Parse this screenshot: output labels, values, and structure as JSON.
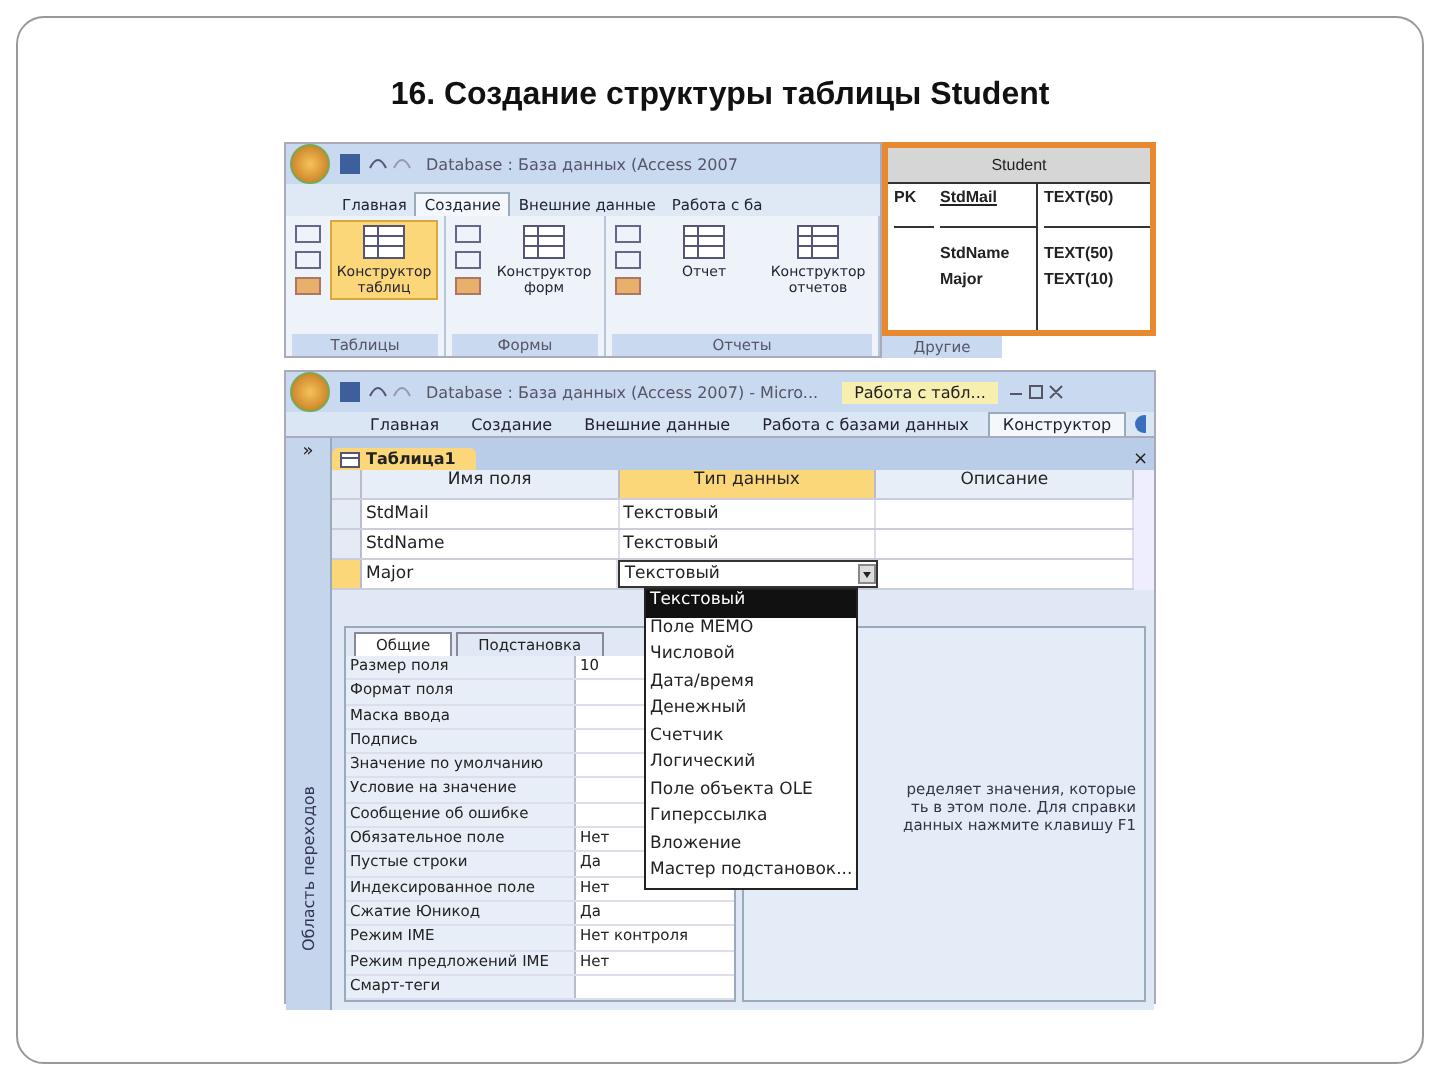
{
  "slide": {
    "title": "16. Создание структуры таблицы Student"
  },
  "ribbon_window": {
    "title": "Database : База данных (Access 2007",
    "tabs": [
      {
        "label": "Главная",
        "selected": false
      },
      {
        "label": "Создание",
        "selected": true
      },
      {
        "label": "Внешние данные",
        "selected": false
      },
      {
        "label": "Работа с ба",
        "selected": false
      }
    ],
    "groups": [
      {
        "label": "Таблицы",
        "buttons": [
          {
            "label": "Конструктор таблиц",
            "selected": true
          }
        ]
      },
      {
        "label": "Формы",
        "buttons": [
          {
            "label": "Конструктор форм",
            "selected": false
          }
        ]
      },
      {
        "label": "Отчеты",
        "buttons": [
          {
            "label": "Отчет",
            "selected": false
          },
          {
            "label": "Конструктор отчетов",
            "selected": false
          }
        ]
      },
      {
        "label": "Другие"
      }
    ]
  },
  "schema": {
    "title": "Student",
    "rows": [
      {
        "key": "PK",
        "name": "StdMail",
        "type": "TEXT(50)",
        "underlined": true
      },
      {
        "key": "",
        "name": "StdName",
        "type": "TEXT(50)",
        "underlined": false
      },
      {
        "key": "",
        "name": "Major",
        "type": "TEXT(10)",
        "underlined": false
      }
    ]
  },
  "design_window": {
    "title": "Database : База данных (Access 2007) - Micro...",
    "context_tab": "Работа с табл...",
    "tabs": [
      {
        "label": "Главная",
        "selected": false
      },
      {
        "label": "Создание",
        "selected": false
      },
      {
        "label": "Внешние данные",
        "selected": false
      },
      {
        "label": "Работа с базами данных",
        "selected": false
      },
      {
        "label": "Конструктор",
        "selected": true
      }
    ],
    "nav_pane": "Область переходов",
    "nav_toggle": "»",
    "document_tab": "Таблица1",
    "close": "×",
    "columns": [
      {
        "label": "Имя поля",
        "selected": false
      },
      {
        "label": "Тип данных",
        "selected": true
      },
      {
        "label": "Описание",
        "selected": false
      }
    ],
    "rows": [
      {
        "name": "StdMail",
        "type": "Текстовый",
        "selected": false
      },
      {
        "name": "StdName",
        "type": "Текстовый",
        "selected": false
      },
      {
        "name": "Major",
        "type": "Текстовый",
        "selected": true
      }
    ],
    "dropdown": [
      {
        "label": "Текстовый",
        "selected": true
      },
      {
        "label": "Поле MEMO",
        "selected": false
      },
      {
        "label": "Числовой",
        "selected": false
      },
      {
        "label": "Дата/время",
        "selected": false
      },
      {
        "label": "Денежный",
        "selected": false
      },
      {
        "label": "Счетчик",
        "selected": false
      },
      {
        "label": "Логический",
        "selected": false
      },
      {
        "label": "Поле объекта OLE",
        "selected": false
      },
      {
        "label": "Гиперссылка",
        "selected": false
      },
      {
        "label": "Вложение",
        "selected": false
      },
      {
        "label": "Мастер подстановок...",
        "selected": false
      }
    ],
    "property_tabs": [
      {
        "label": "Общие",
        "selected": true
      },
      {
        "label": "Подстановка",
        "selected": false
      }
    ],
    "properties": [
      {
        "name": "Размер поля",
        "value": "10"
      },
      {
        "name": "Формат поля"
      },
      {
        "name": "Маска ввода"
      },
      {
        "name": "Подпись"
      },
      {
        "name": "Значение по умолчанию"
      },
      {
        "name": "Условие на значение"
      },
      {
        "name": "Сообщение об ошибке"
      },
      {
        "name": "Обязательное поле",
        "value": "Нет"
      },
      {
        "name": "Пустые строки",
        "value": "Да"
      },
      {
        "name": "Индексированное поле",
        "value": "Нет"
      },
      {
        "name": "Сжатие Юникод",
        "value": "Да"
      },
      {
        "name": "Режим IME",
        "value": "Нет контроля"
      },
      {
        "name": "Режим предложений IME",
        "value": "Нет"
      },
      {
        "name": "Смарт-теги"
      }
    ],
    "help_lines": [
      "ределяет значения, которые",
      "ть в этом поле. Для справки",
      "данных нажмите клавишу F1"
    ]
  }
}
